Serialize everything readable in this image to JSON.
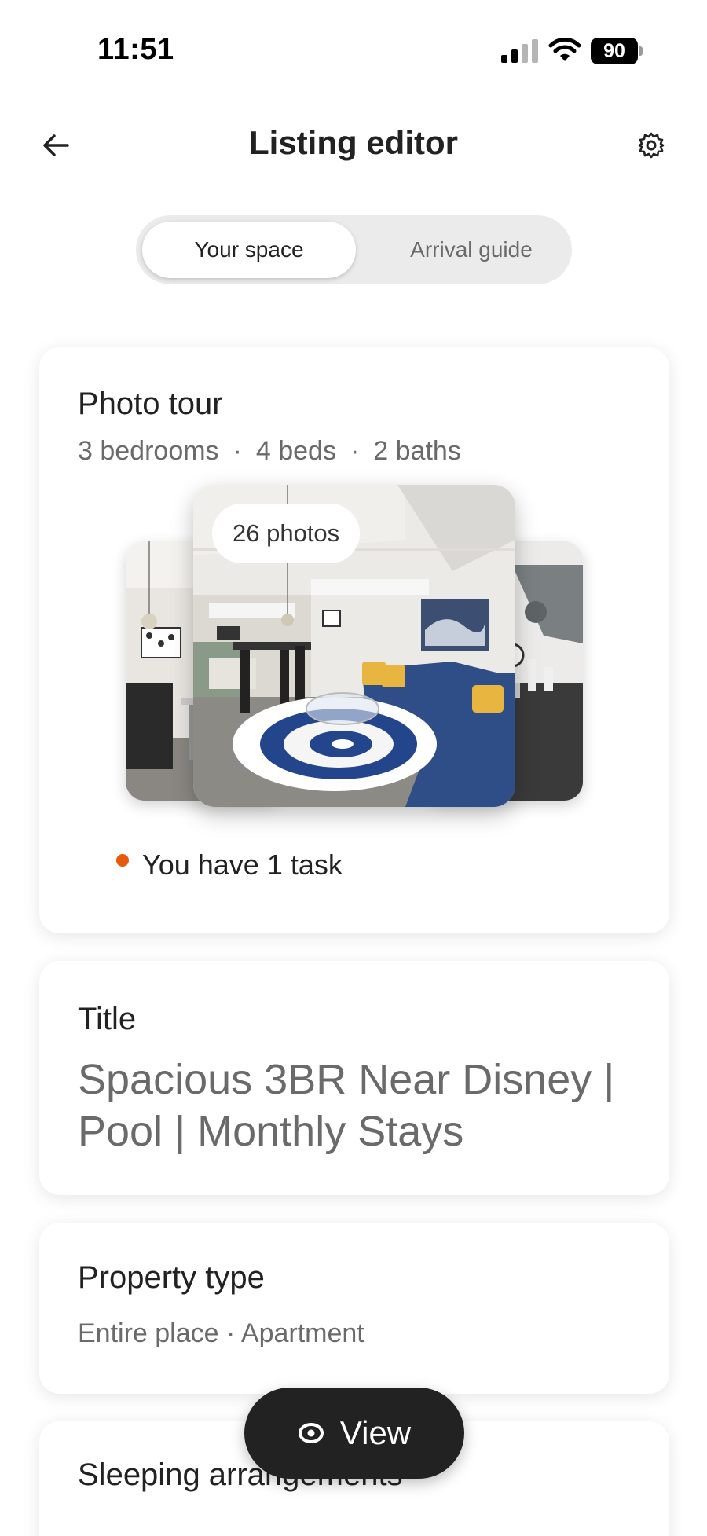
{
  "status_bar": {
    "time": "11:51",
    "battery": "90",
    "icons": [
      "signal-icon",
      "wifi-icon",
      "battery-icon"
    ]
  },
  "header": {
    "title": "Listing editor",
    "back_icon": "arrow-left-icon",
    "settings_icon": "gear-icon"
  },
  "tabs": [
    {
      "label": "Your space",
      "active": true
    },
    {
      "label": "Arrival guide",
      "active": false
    }
  ],
  "photo_tour": {
    "heading": "Photo tour",
    "bedrooms": "3 bedrooms",
    "beds": "4 beds",
    "baths": "2 baths",
    "separator": "·",
    "photo_count": "26 photos",
    "task_text": "You have 1 task",
    "task_dot_color": "#e8590c"
  },
  "title_card": {
    "label": "Title",
    "value": "Spacious 3BR Near Disney | Pool | Monthly Stays"
  },
  "property_card": {
    "label": "Property type",
    "value": "Entire place · Apartment"
  },
  "sleeping_card": {
    "label": "Sleeping arrangements"
  },
  "view_button": {
    "label": "View",
    "icon": "eye-icon"
  }
}
